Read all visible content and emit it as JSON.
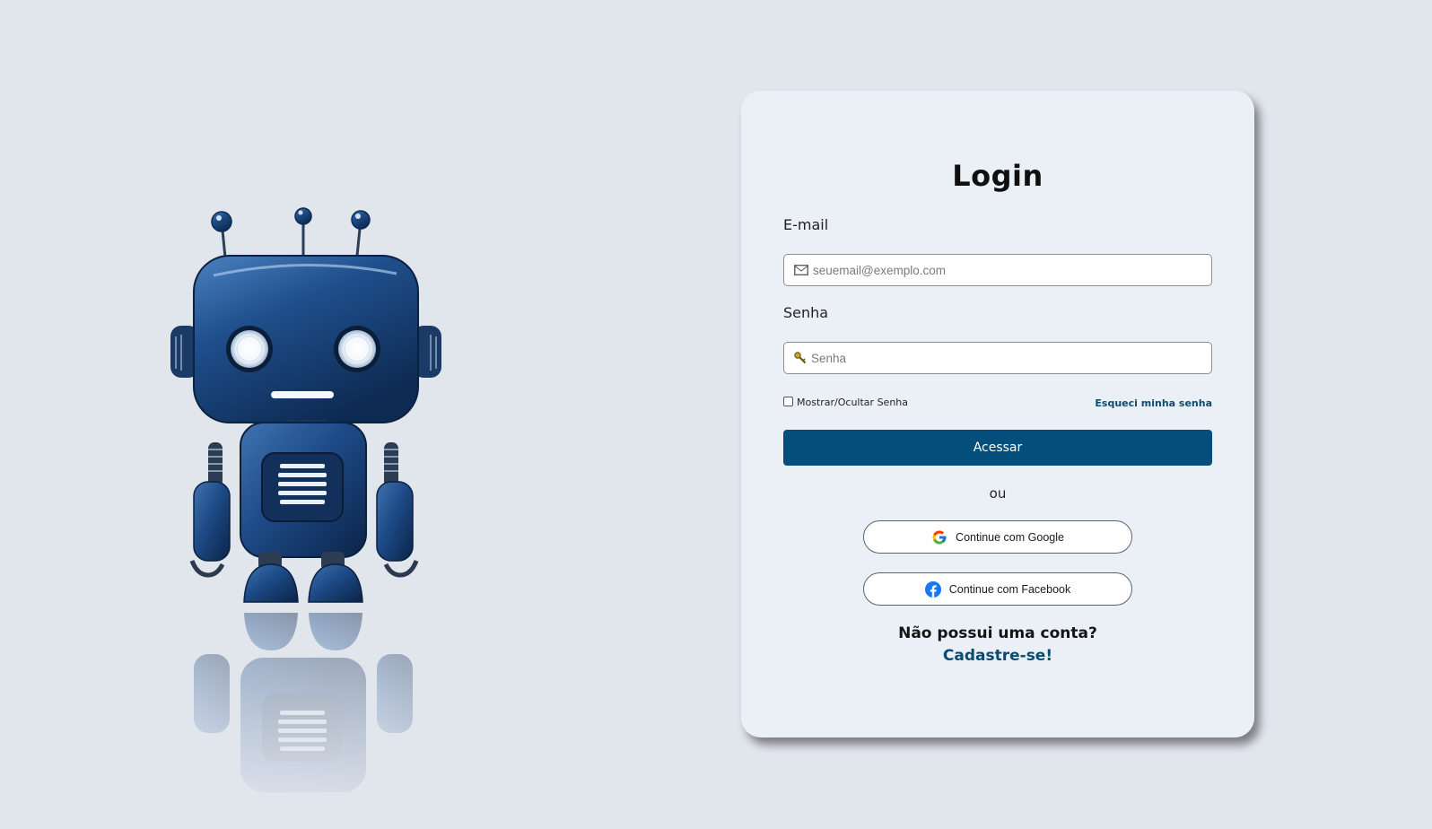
{
  "login": {
    "title": "Login",
    "email_label": "E-mail",
    "email_placeholder": "seuemail@exemplo.com",
    "password_label": "Senha",
    "password_placeholder": "Senha",
    "show_password_label": "Mostrar/Ocultar Senha",
    "forgot_password": "Esqueci minha senha",
    "submit_label": "Acessar",
    "or_text": "ou",
    "google_label": "Continue com Google",
    "facebook_label": "Continue com Facebook",
    "no_account_text": "Não possui uma conta?",
    "signup_link": "Cadastre-se!"
  },
  "icons": {
    "email": "envelope-icon",
    "password": "key-icon",
    "google": "google-logo-icon",
    "facebook": "facebook-logo-icon"
  },
  "colors": {
    "page_background": "#e1e5ec",
    "card_background": "#ebf0f6",
    "primary_button": "#044e7b",
    "link": "#0c4a6e"
  }
}
